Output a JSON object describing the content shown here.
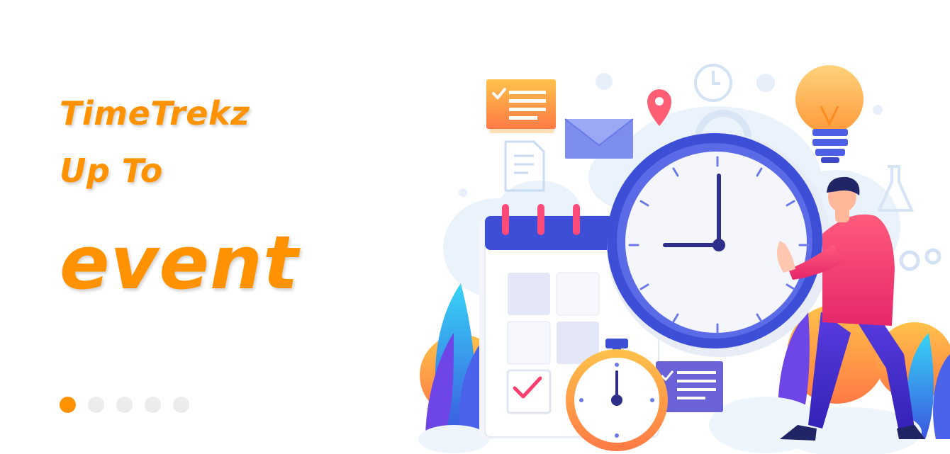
{
  "slide": {
    "title_line1": "TimeTrekz",
    "title_line2": "Up To",
    "title_line3": "event"
  },
  "carousel": {
    "total_dots": 5,
    "active_index": 0
  },
  "colors": {
    "accent": "#ff9200",
    "dot_inactive": "#ececec",
    "clock_ring": "#3d4fd6",
    "person_shirt": "#ef3f72"
  },
  "clock": {
    "time_shown": "9:00"
  },
  "illustration_icons": [
    "checklist-note-icon",
    "document-icon",
    "envelope-icon",
    "location-pin-icon",
    "wall-clock-icon",
    "gear-icon",
    "lightbulb-icon",
    "flask-icon",
    "calendar-icon",
    "alarm-clock-icon",
    "stopwatch-icon",
    "person-icon"
  ]
}
